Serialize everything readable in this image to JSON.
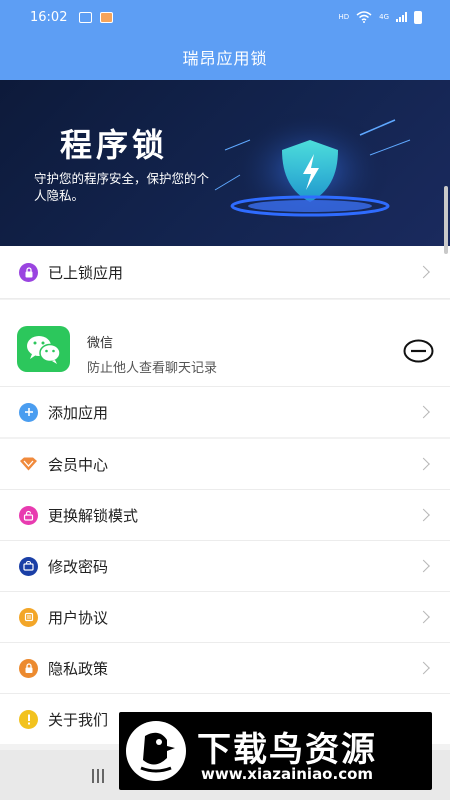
{
  "status_bar": {
    "time": "16:02",
    "network_label": "HD",
    "cellular_label": "4G"
  },
  "header": {
    "title": "瑞昂应用锁"
  },
  "banner": {
    "title": "程序锁",
    "subtitle": "守护您的程序安全，保护您的个人隐私。"
  },
  "locked_apps": {
    "label": "已上锁应用"
  },
  "locked_app_item": {
    "name": "微信",
    "description": "防止他人查看聊天记录"
  },
  "add_app": {
    "label": "添加应用"
  },
  "menu": [
    {
      "label": "会员中心",
      "icon": "diamond-icon",
      "color": "#f08a3c"
    },
    {
      "label": "更换解锁模式",
      "icon": "unlock-icon",
      "color": "#e83bb0"
    },
    {
      "label": "修改密码",
      "icon": "password-icon",
      "color": "#1a3fa6"
    },
    {
      "label": "用户协议",
      "icon": "document-icon",
      "color": "#f3a628"
    },
    {
      "label": "隐私政策",
      "icon": "privacy-icon",
      "color": "#ec8a2f"
    },
    {
      "label": "关于我们",
      "icon": "info-icon",
      "color": "#f2c21e"
    }
  ],
  "watermark": {
    "title": "下载鸟资源",
    "url": "www.xiazainiao.com"
  },
  "colors": {
    "primary": "#5d9ef4",
    "banner": "#13244f",
    "wechat": "#2cc75c"
  }
}
